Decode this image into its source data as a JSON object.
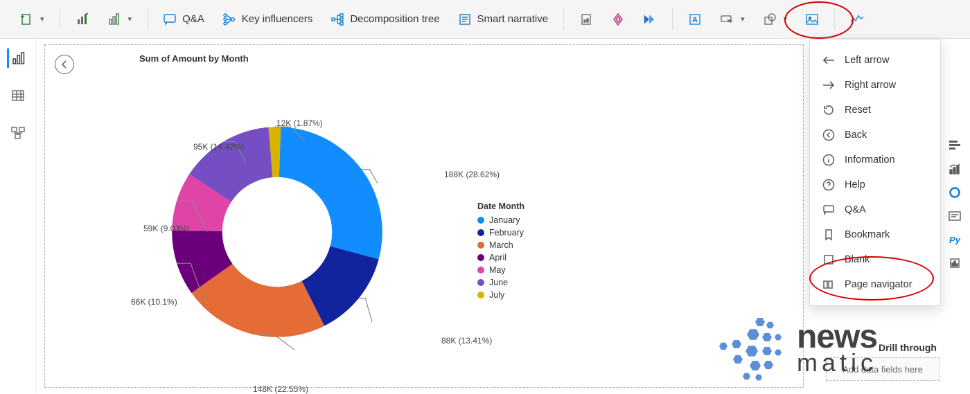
{
  "toolbar": {
    "qa_label": "Q&A",
    "key_influencers_label": "Key influencers",
    "decomp_label": "Decomposition tree",
    "smart_narrative_label": "Smart narrative"
  },
  "chart": {
    "title": "Sum of Amount by Month",
    "legend_title": "Date Month"
  },
  "chart_data": {
    "type": "donut",
    "title": "Sum of Amount by Month",
    "legend_title": "Date Month",
    "series": [
      {
        "name": "January",
        "value": 188000,
        "label": "188K (28.62%)",
        "pct": 28.62,
        "color": "#118dff"
      },
      {
        "name": "February",
        "value": 88000,
        "label": "88K (13.41%)",
        "pct": 13.41,
        "color": "#12239e"
      },
      {
        "name": "March",
        "value": 148000,
        "label": "148K (22.55%)",
        "pct": 22.55,
        "color": "#e66c37"
      },
      {
        "name": "April",
        "value": 66000,
        "label": "66K (10.1%)",
        "pct": 10.1,
        "color": "#6b007b"
      },
      {
        "name": "May",
        "value": 59000,
        "label": "59K (9.03%)",
        "pct": 9.03,
        "color": "#e044a7"
      },
      {
        "name": "June",
        "value": 95000,
        "label": "95K (14.42%)",
        "pct": 14.42,
        "color": "#744ec2"
      },
      {
        "name": "July",
        "value": 12000,
        "label": "12K (1.87%)",
        "pct": 1.87,
        "color": "#d9b300"
      }
    ]
  },
  "dropdown": {
    "left_arrow": "Left arrow",
    "right_arrow": "Right arrow",
    "reset": "Reset",
    "back": "Back",
    "information": "Information",
    "help": "Help",
    "qa": "Q&A",
    "bookmark": "Bookmark",
    "blank": "Blank",
    "page_navigator": "Page navigator"
  },
  "viz_rail": {
    "py_label": "Py"
  },
  "right_pane": {
    "drill_through": "Drill through",
    "add_fields": "Add data fields here"
  },
  "watermark": {
    "line1": "news",
    "line2": "matic"
  }
}
